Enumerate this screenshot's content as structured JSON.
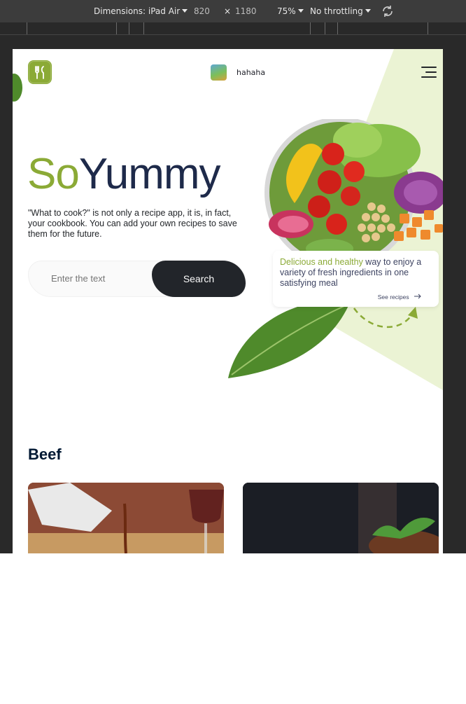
{
  "devtools": {
    "dimensions_label": "Dimensions: iPad Air",
    "width": "820",
    "times": "×",
    "height": "1180",
    "zoom": "75%",
    "throttling": "No throttling",
    "rotate_icon": "rotate-icon"
  },
  "header": {
    "logo_icon": "fork-knife-icon",
    "username": "hahaha",
    "menu_icon": "hamburger-icon"
  },
  "hero": {
    "title_part1": "So",
    "title_part2": "Yummy",
    "description": "\"What to cook?\" is not only a recipe app, it is, in fact, your cookbook. You can add your own recipes to save them for the future.",
    "search_placeholder": "Enter the text",
    "search_button": "Search"
  },
  "promo_card": {
    "accent_text": "Delicious and healthy",
    "text": " way to enjoy a variety of fresh ingredients in one satisfying meal",
    "link": "See recipes",
    "link_icon": "arrow-right-icon"
  },
  "section": {
    "title": "Beef"
  },
  "colors": {
    "accent": "#8baa36",
    "dark": "#22252a",
    "title": "#1e2a4a",
    "background_triangle": "#ebf3d4"
  }
}
